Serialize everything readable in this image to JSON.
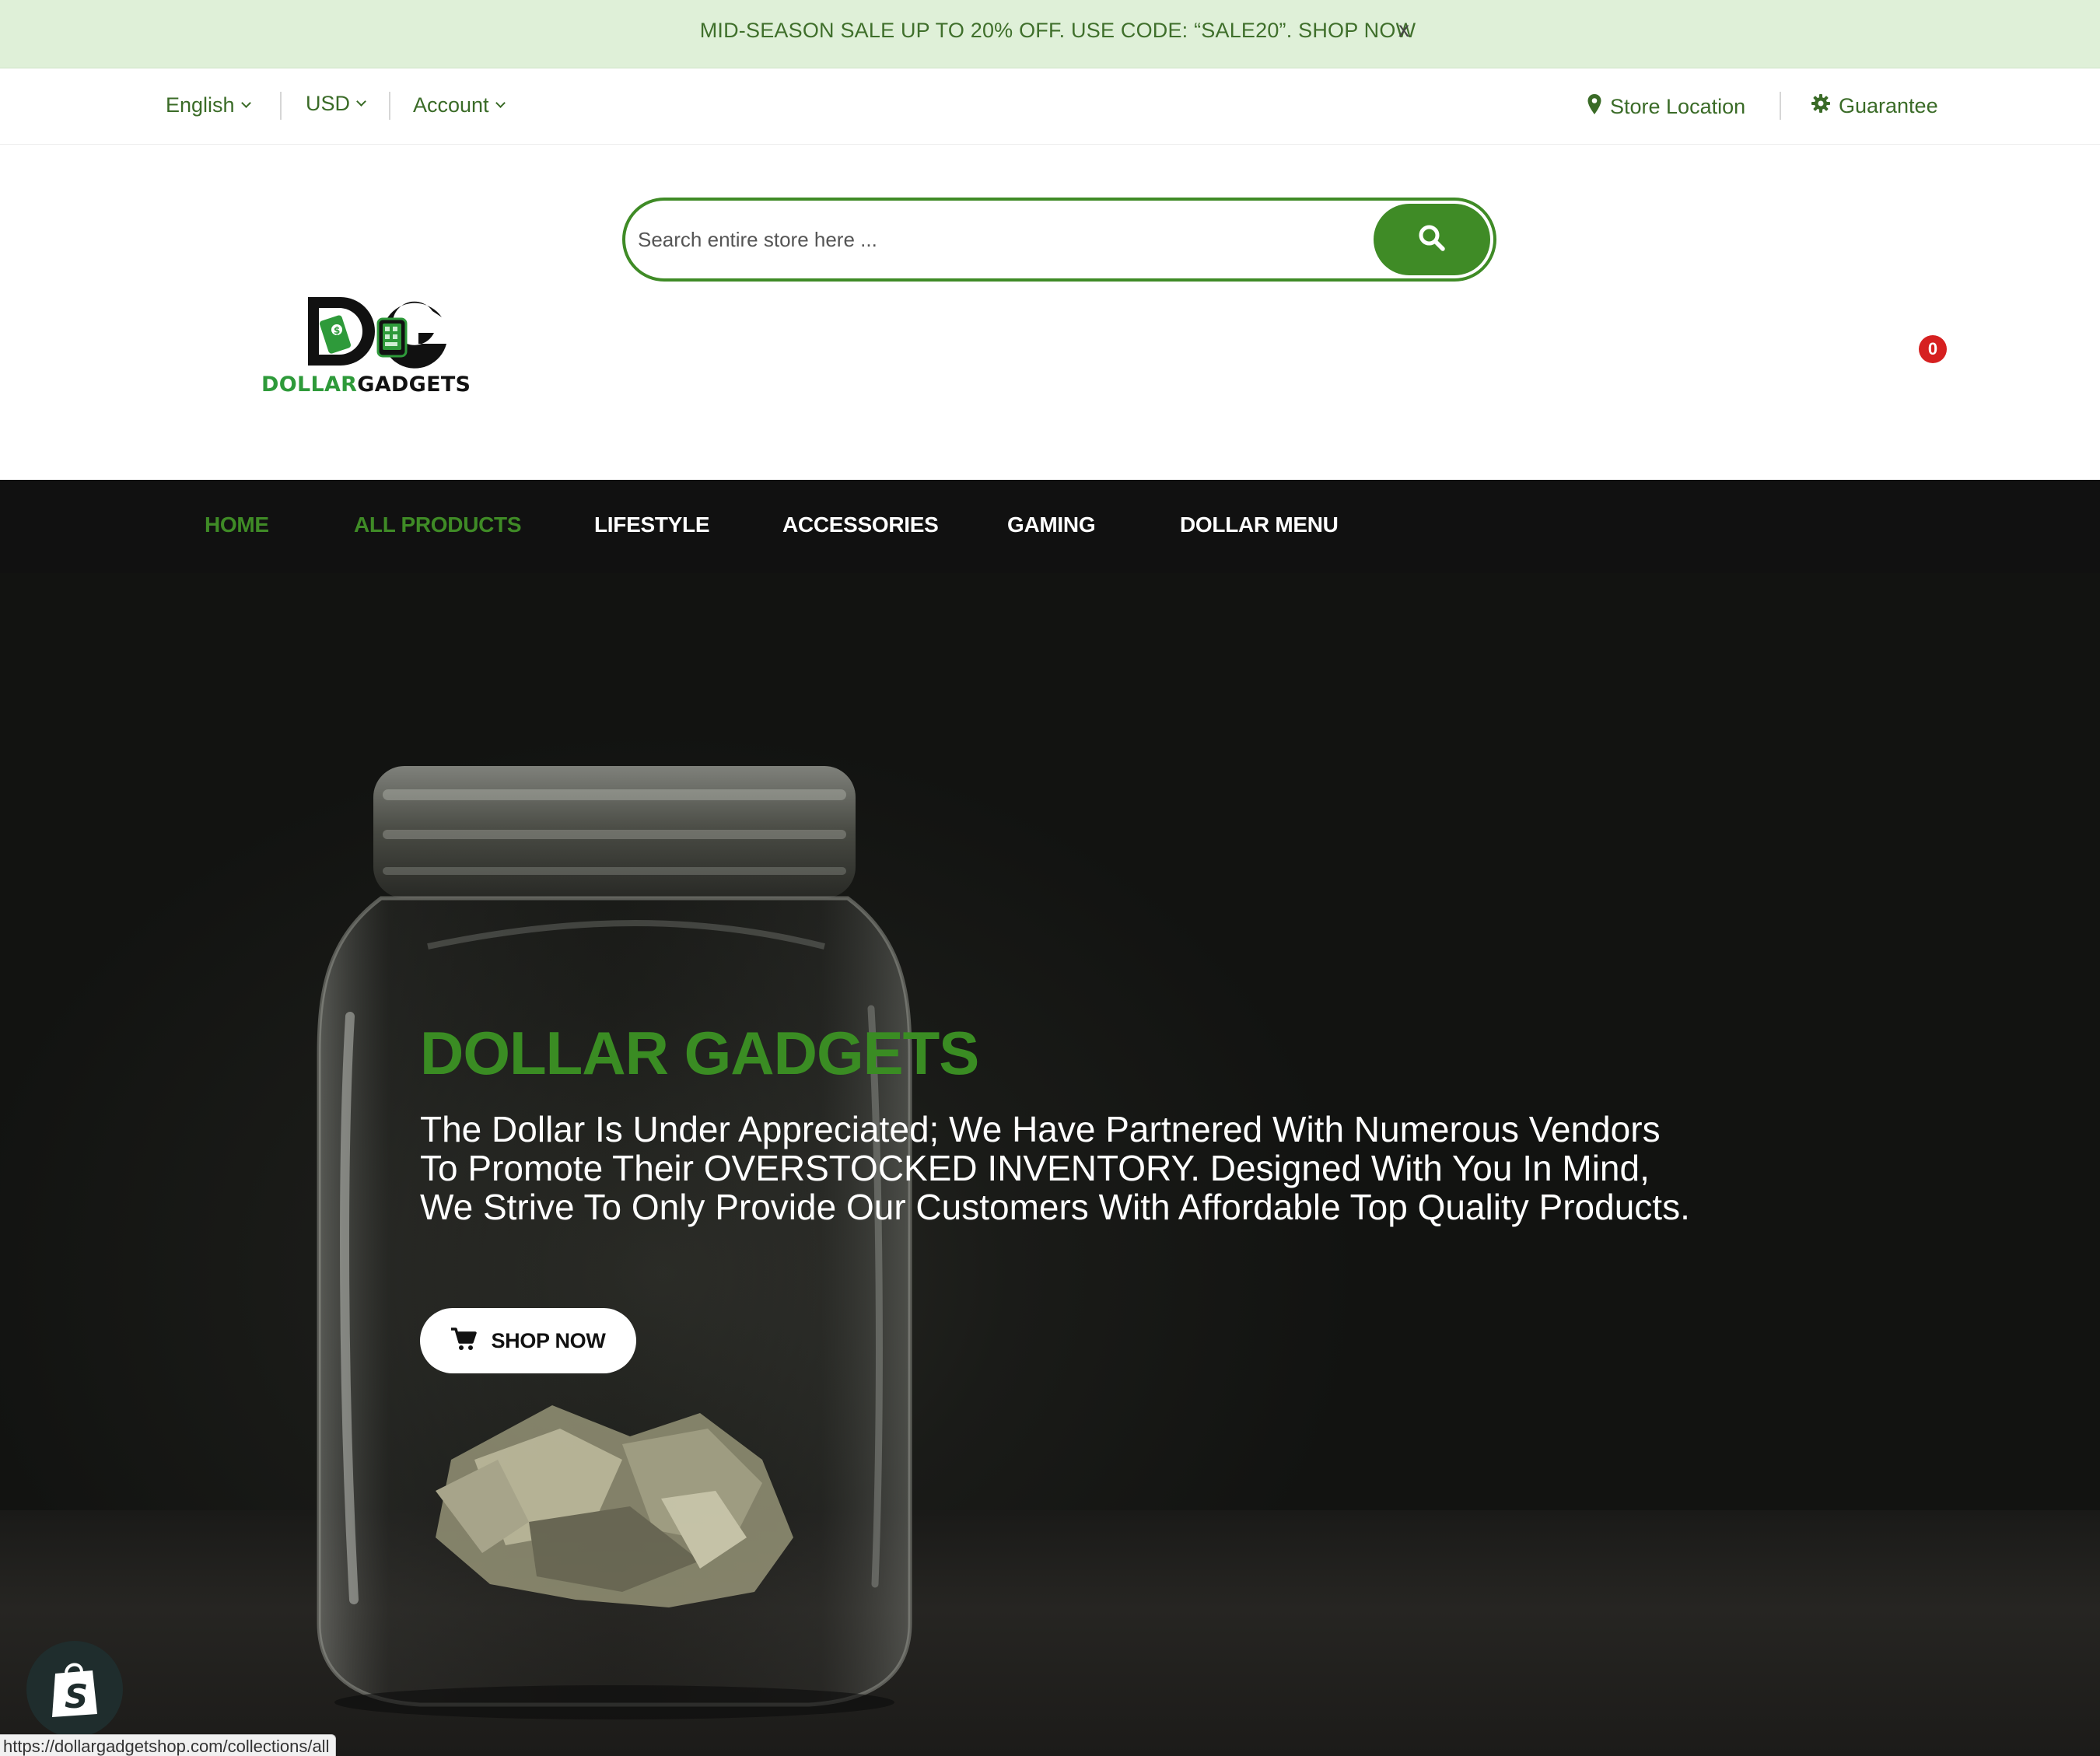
{
  "announcement": {
    "text": "MID-SEASON SALE UP TO 20% OFF. USE CODE: “SALE20”. SHOP NOW",
    "close_label": "x"
  },
  "utility": {
    "language": "English",
    "currency": "USD",
    "account": "Account",
    "store_location": "Store Location",
    "guarantee": "Guarantee"
  },
  "search": {
    "placeholder": "Search entire store here ..."
  },
  "logo": {
    "word1": "DOLLAR",
    "word2": "GADGETS"
  },
  "cart": {
    "count": "0"
  },
  "nav": {
    "items": [
      {
        "label": "HOME",
        "active": true
      },
      {
        "label": "ALL PRODUCTS",
        "active": true
      },
      {
        "label": "LIFESTYLE",
        "active": false
      },
      {
        "label": "ACCESSORIES",
        "active": false
      },
      {
        "label": "GAMING",
        "active": false
      },
      {
        "label": "DOLLAR MENU",
        "active": false
      }
    ]
  },
  "hero": {
    "title": "DOLLAR GADGETS",
    "body": "The Dollar Is Under Appreciated; We Have Partnered With Numerous Vendors To Promote Their OVERSTOCKED INVENTORY. Designed With You In Mind, We Strive To Only Provide Our Customers With Affordable Top Quality Products.",
    "button_label": "SHOP NOW"
  },
  "status_bar": {
    "url": "https://dollargadgetshop.com/collections/all"
  },
  "colors": {
    "brand_green": "#3f8b26",
    "announcement_bg": "#dff0d8",
    "nav_bg": "#111111",
    "cart_badge": "#d62020"
  }
}
